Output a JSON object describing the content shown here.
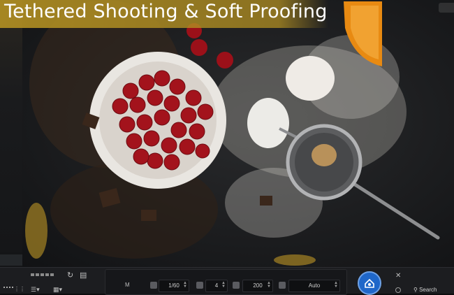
{
  "title": "Tethered Shooting & Soft Proofing",
  "toolbar": {
    "mode": "M",
    "shutter": "1/60",
    "aperture": "4",
    "iso": "200",
    "white_balance": "Auto",
    "search_label": "Search"
  },
  "icons": {
    "capture": "camera-capture-icon",
    "rotate": "rotate-icon",
    "compare": "compare-icon",
    "close": "close-icon",
    "search": "search-icon"
  },
  "colors": {
    "banner": "#b08e22",
    "capture_button": "#1f67c9"
  }
}
